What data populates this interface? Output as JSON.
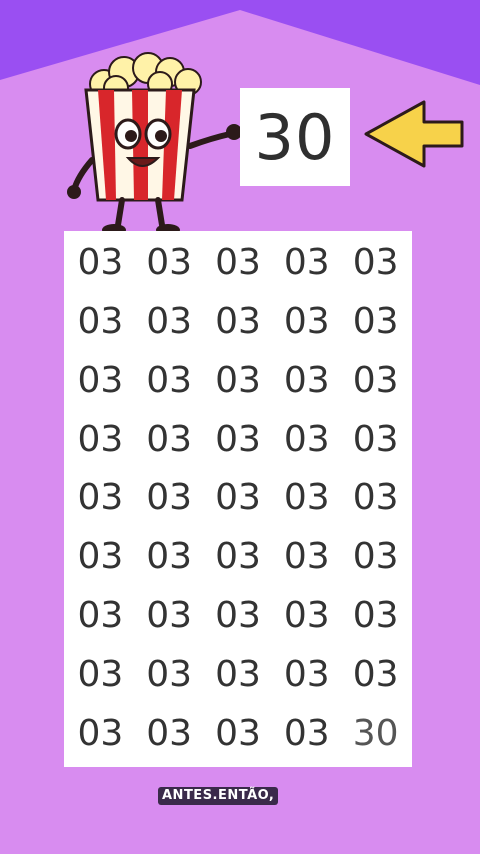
{
  "target": {
    "value": "30"
  },
  "grid": {
    "columns": 5,
    "rows": 9,
    "cells": [
      "03",
      "03",
      "03",
      "03",
      "03",
      "03",
      "03",
      "03",
      "03",
      "03",
      "03",
      "03",
      "03",
      "03",
      "03",
      "03",
      "03",
      "03",
      "03",
      "03",
      "03",
      "03",
      "03",
      "03",
      "03",
      "03",
      "03",
      "03",
      "03",
      "03",
      "03",
      "03",
      "03",
      "03",
      "03",
      "03",
      "03",
      "03",
      "03",
      "03",
      "03",
      "03",
      "03",
      "03",
      "30"
    ]
  },
  "brand": {
    "label": "ANTES.ENTÃO,"
  },
  "colors": {
    "background": "#d88cf0",
    "top_band": "#9a4ff2",
    "arrow": "#f7d24a",
    "panel": "#ffffff",
    "text": "#333333"
  },
  "icons": {
    "mascot": "popcorn-mascot-icon",
    "arrow": "left-arrow-icon"
  }
}
